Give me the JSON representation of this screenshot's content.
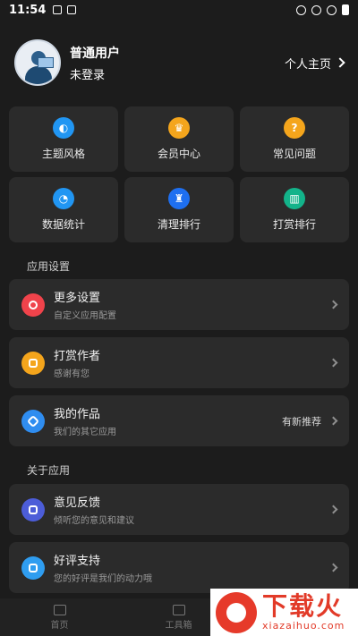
{
  "statusbar": {
    "time": "11:54"
  },
  "profile": {
    "name": "普通用户",
    "status": "未登录",
    "home_link": "个人主页"
  },
  "grid": [
    {
      "label": "主题风格",
      "color": "#2196f3"
    },
    {
      "label": "会员中心",
      "color": "#f4a51c"
    },
    {
      "label": "常见问题",
      "color": "#f4a51c"
    },
    {
      "label": "数据统计",
      "color": "#2196f3"
    },
    {
      "label": "清理排行",
      "color": "#1e6ff0"
    },
    {
      "label": "打赏排行",
      "color": "#13b38a"
    }
  ],
  "sections": {
    "app_settings": "应用设置",
    "about_app": "关于应用"
  },
  "rows": [
    {
      "title": "更多设置",
      "subtitle": "自定义应用配置",
      "extra": "",
      "color": "#f0434b"
    },
    {
      "title": "打赏作者",
      "subtitle": "感谢有您",
      "extra": "",
      "color": "#f4a51c"
    },
    {
      "title": "我的作品",
      "subtitle": "我们的其它应用",
      "extra": "有新推荐",
      "color": "#2f8df0"
    },
    {
      "title": "意见反馈",
      "subtitle": "倾听您的意见和建议",
      "extra": "",
      "color": "#4c5dd8"
    },
    {
      "title": "好评支持",
      "subtitle": "您的好评是我们的动力哦",
      "extra": "",
      "color": "#2f9df0"
    }
  ],
  "bottom_tabs": [
    {
      "label": "首页"
    },
    {
      "label": "工具箱"
    }
  ],
  "watermark": {
    "title": "下载火",
    "url": "xiazaihuo.com"
  }
}
